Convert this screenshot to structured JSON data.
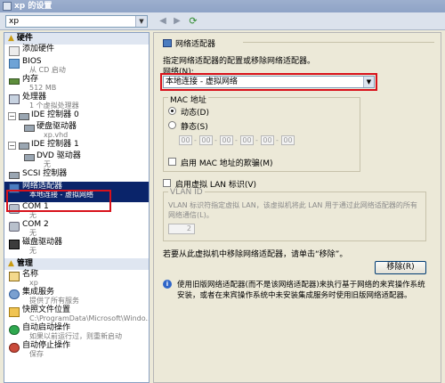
{
  "window": {
    "title": "xp 的设置"
  },
  "toolbar": {
    "vm_name": "xp"
  },
  "sidebar": {
    "hardware_header": "硬件",
    "management_header": "管理",
    "hardware_items": [
      {
        "title": "添加硬件",
        "sub": ""
      },
      {
        "title": "BIOS",
        "sub": "从 CD 启动"
      },
      {
        "title": "内存",
        "sub": "512 MB"
      },
      {
        "title": "处理器",
        "sub": "1 个虚拟处理器"
      },
      {
        "title": "IDE 控制器 0",
        "sub": ""
      },
      {
        "title": "硬盘驱动器",
        "sub": "xp.vhd"
      },
      {
        "title": "IDE 控制器 1",
        "sub": ""
      },
      {
        "title": "DVD 驱动器",
        "sub": "无"
      },
      {
        "title": "SCSI 控制器",
        "sub": ""
      },
      {
        "title": "网络适配器",
        "sub": "本地连接 - 虚拟网络"
      },
      {
        "title": "COM 1",
        "sub": "无"
      },
      {
        "title": "COM 2",
        "sub": "无"
      },
      {
        "title": "磁盘驱动器",
        "sub": "无"
      }
    ],
    "management_items": [
      {
        "title": "名称",
        "sub": "xp"
      },
      {
        "title": "集成服务",
        "sub": "提供了所有服务"
      },
      {
        "title": "快照文件位置",
        "sub": "C:\\ProgramData\\Microsoft\\Windo..."
      },
      {
        "title": "自动启动操作",
        "sub": "如果以前运行过，则重新启动"
      },
      {
        "title": "自动停止操作",
        "sub": "保存"
      }
    ]
  },
  "panel": {
    "section_title": "网络适配器",
    "description": "指定网络适配器的配置或移除网络适配器。",
    "network_label": "网络(N):",
    "network_value": "本地连接 - 虚拟网络",
    "mac_title": "MAC 地址",
    "mac_dynamic": "动态(D)",
    "mac_static": "静态(S)",
    "mac_fields": [
      "00",
      "00",
      "00",
      "00",
      "00",
      "00"
    ],
    "mac_spoofing": "启用 MAC 地址的欺骗(M)",
    "vlan_enable": "启用虚拟 LAN 标识(V)",
    "vlan_title": "VLAN ID",
    "vlan_desc_1": "VLAN 标识符指定虚拟 LAN，该虚拟机将此 LAN 用于通过此网络适配器的所有",
    "vlan_desc_2": "网络通信(L)。",
    "vlan_value": "2",
    "remove_hint": "若要从此虚拟机中移除网络适配器，请单击“移除”。",
    "remove_button": "移除(R)",
    "info_1": "使用旧版网络适配器(而不是该网络适配器)来执行基于网络的来宾操作系统",
    "info_2": "安装，或者在来宾操作系统中未安装集成服务时使用旧版网络适配器。"
  }
}
